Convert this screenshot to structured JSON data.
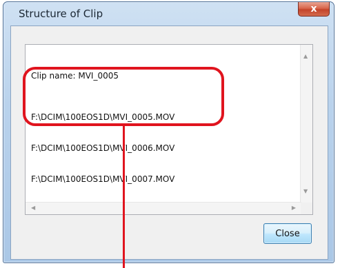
{
  "window": {
    "title": "Structure of Clip",
    "close_glyph": "x"
  },
  "text_area": {
    "clip_name": "Clip name: MVI_0005",
    "files": [
      "F:\\DCIM\\100EOS1D\\MVI_0005.MOV",
      "F:\\DCIM\\100EOS1D\\MVI_0006.MOV",
      "F:\\DCIM\\100EOS1D\\MVI_0007.MOV"
    ]
  },
  "buttons": {
    "close_label": "Close"
  },
  "icons": {
    "scroll_up": "up-arrow-icon",
    "scroll_down": "down-arrow-icon",
    "scroll_left": "left-arrow-icon",
    "scroll_right": "right-arrow-icon"
  },
  "colors": {
    "highlight": "#e0141e",
    "window_frame": "#aac7e6",
    "close_x": "#c4442a"
  }
}
